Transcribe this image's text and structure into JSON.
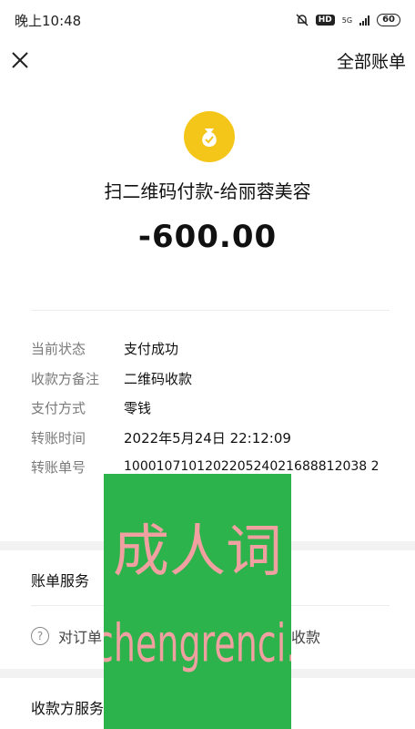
{
  "status_bar": {
    "time": "晚上10:48",
    "hd": "HD",
    "network": "5G",
    "battery": "60"
  },
  "header": {
    "all_bills_label": "全部账单"
  },
  "transaction": {
    "title": "扫二维码付款-给丽蓉美容",
    "amount": "-600.00"
  },
  "details": [
    {
      "label": "当前状态",
      "value": "支付成功"
    },
    {
      "label": "收款方备注",
      "value": "二维码收款"
    },
    {
      "label": "支付方式",
      "value": "零钱"
    },
    {
      "label": "转账时间",
      "value": "2022年5月24日 22:12:09"
    },
    {
      "label": "转账单号",
      "value": "100010710120220524021688812038 2"
    }
  ],
  "services": {
    "bill_service_title": "账单服务",
    "help_icon_glyph": "?",
    "order_link_left": "对订单",
    "order_link_right": "收款",
    "payee_service_title": "收款方服务"
  },
  "watermark": {
    "cn": "成人词",
    "en": "chengrenci.com"
  },
  "colors": {
    "icon_yellow": "#f5c61a",
    "watermark_green": "#2db34b",
    "watermark_text": "#f0a0a0"
  }
}
